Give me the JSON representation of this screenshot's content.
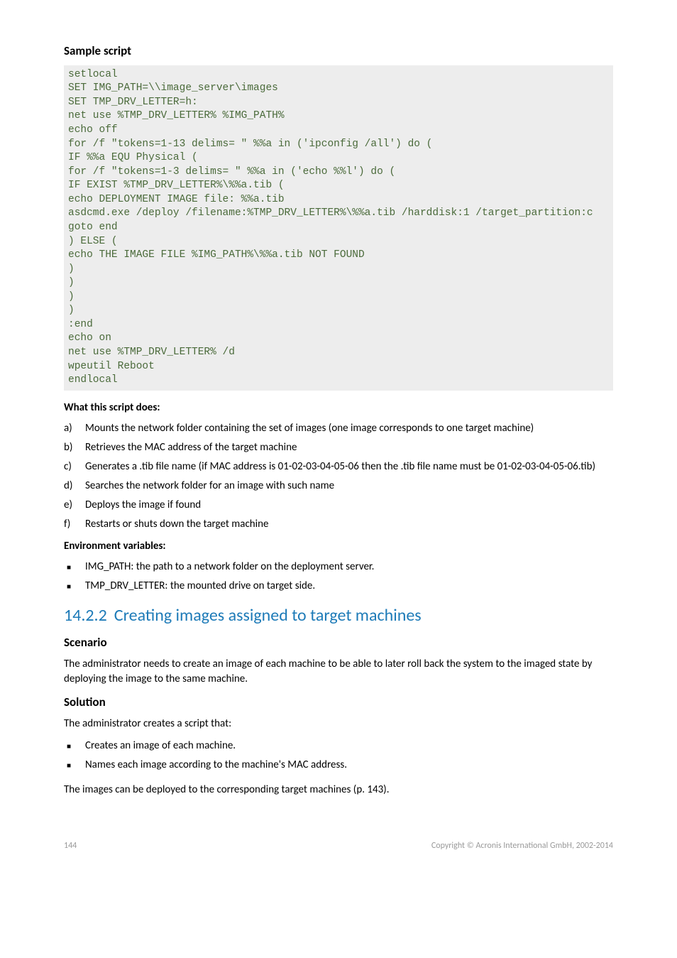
{
  "sample_heading": "Sample script",
  "code_lines": [
    "setlocal",
    "SET IMG_PATH=\\\\image_server\\images",
    "SET TMP_DRV_LETTER=h:",
    "net use %TMP_DRV_LETTER% %IMG_PATH%",
    "echo off",
    "for /f \"tokens=1-13 delims= \" %%a in ('ipconfig /all') do (",
    "IF %%a EQU Physical (",
    "for /f \"tokens=1-3 delims= \" %%a in ('echo %%l') do (",
    "IF EXIST %TMP_DRV_LETTER%\\%%a.tib (",
    "echo DEPLOYMENT IMAGE file: %%a.tib",
    "asdcmd.exe /deploy /filename:%TMP_DRV_LETTER%\\%%a.tib /harddisk:1 /target_partition:c",
    "goto end",
    ") ELSE (",
    "echo THE IMAGE FILE %IMG_PATH%\\%%a.tib NOT FOUND",
    ")",
    ")",
    ")",
    ")",
    ":end",
    "echo on",
    "net use %TMP_DRV_LETTER% /d",
    "wpeutil Reboot",
    "endlocal"
  ],
  "what_heading": "What this script does:",
  "lettered": [
    {
      "m": "a)",
      "t": "Mounts the network folder containing the set of images (one image corresponds to one target machine)"
    },
    {
      "m": "b)",
      "t": "Retrieves the MAC address of the target machine"
    },
    {
      "m": "c)",
      "t": "Generates a .tib file name (if MAC address is 01-02-03-04-05-06 then the .tib file name must be 01-02-03-04-05-06.tib)"
    },
    {
      "m": "d)",
      "t": "Searches the network folder for an image with such name"
    },
    {
      "m": "e)",
      "t": "Deploys the image if found"
    },
    {
      "m": "f)",
      "t": "Restarts or shuts down the target machine"
    }
  ],
  "env_heading": "Environment variables:",
  "env_items": [
    "IMG_PATH: the path to a network folder on the deployment server.",
    "TMP_DRV_LETTER: the mounted drive on target side."
  ],
  "section_num": "14.2.2",
  "section_title": "Creating images assigned to target machines",
  "scenario_heading": "Scenario",
  "scenario_body": "The administrator needs to create an image of each machine to be able to later roll back the system to the imaged state by deploying the image to the same machine.",
  "solution_heading": "Solution",
  "solution_intro": "The administrator creates a script that:",
  "solution_items": [
    "Creates an image of each machine.",
    "Names each image according to the machine's MAC address."
  ],
  "closing": "The images can be deployed to the corresponding target machines (p. 143).",
  "footer_left": "144",
  "footer_right": "Copyright © Acronis International GmbH, 2002-2014"
}
